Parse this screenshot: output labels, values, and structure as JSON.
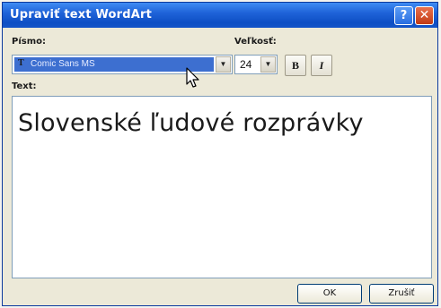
{
  "window": {
    "title": "Upraviť text WordArt",
    "help_glyph": "?",
    "close_glyph": "✕"
  },
  "font": {
    "label": "Písmo:",
    "value": "Comic Sans MS",
    "type_icon": "T"
  },
  "size": {
    "label": "Veľkosť:",
    "value": "24"
  },
  "format": {
    "bold_label": "B",
    "italic_label": "I"
  },
  "text": {
    "label": "Text:",
    "value": "Slovenské ľudové rozprávky"
  },
  "buttons": {
    "ok_label": "OK",
    "cancel_label": "Zrušiť"
  },
  "icons": {
    "dropdown": "chevron-down-icon",
    "cursor": "mouse-pointer-icon"
  }
}
